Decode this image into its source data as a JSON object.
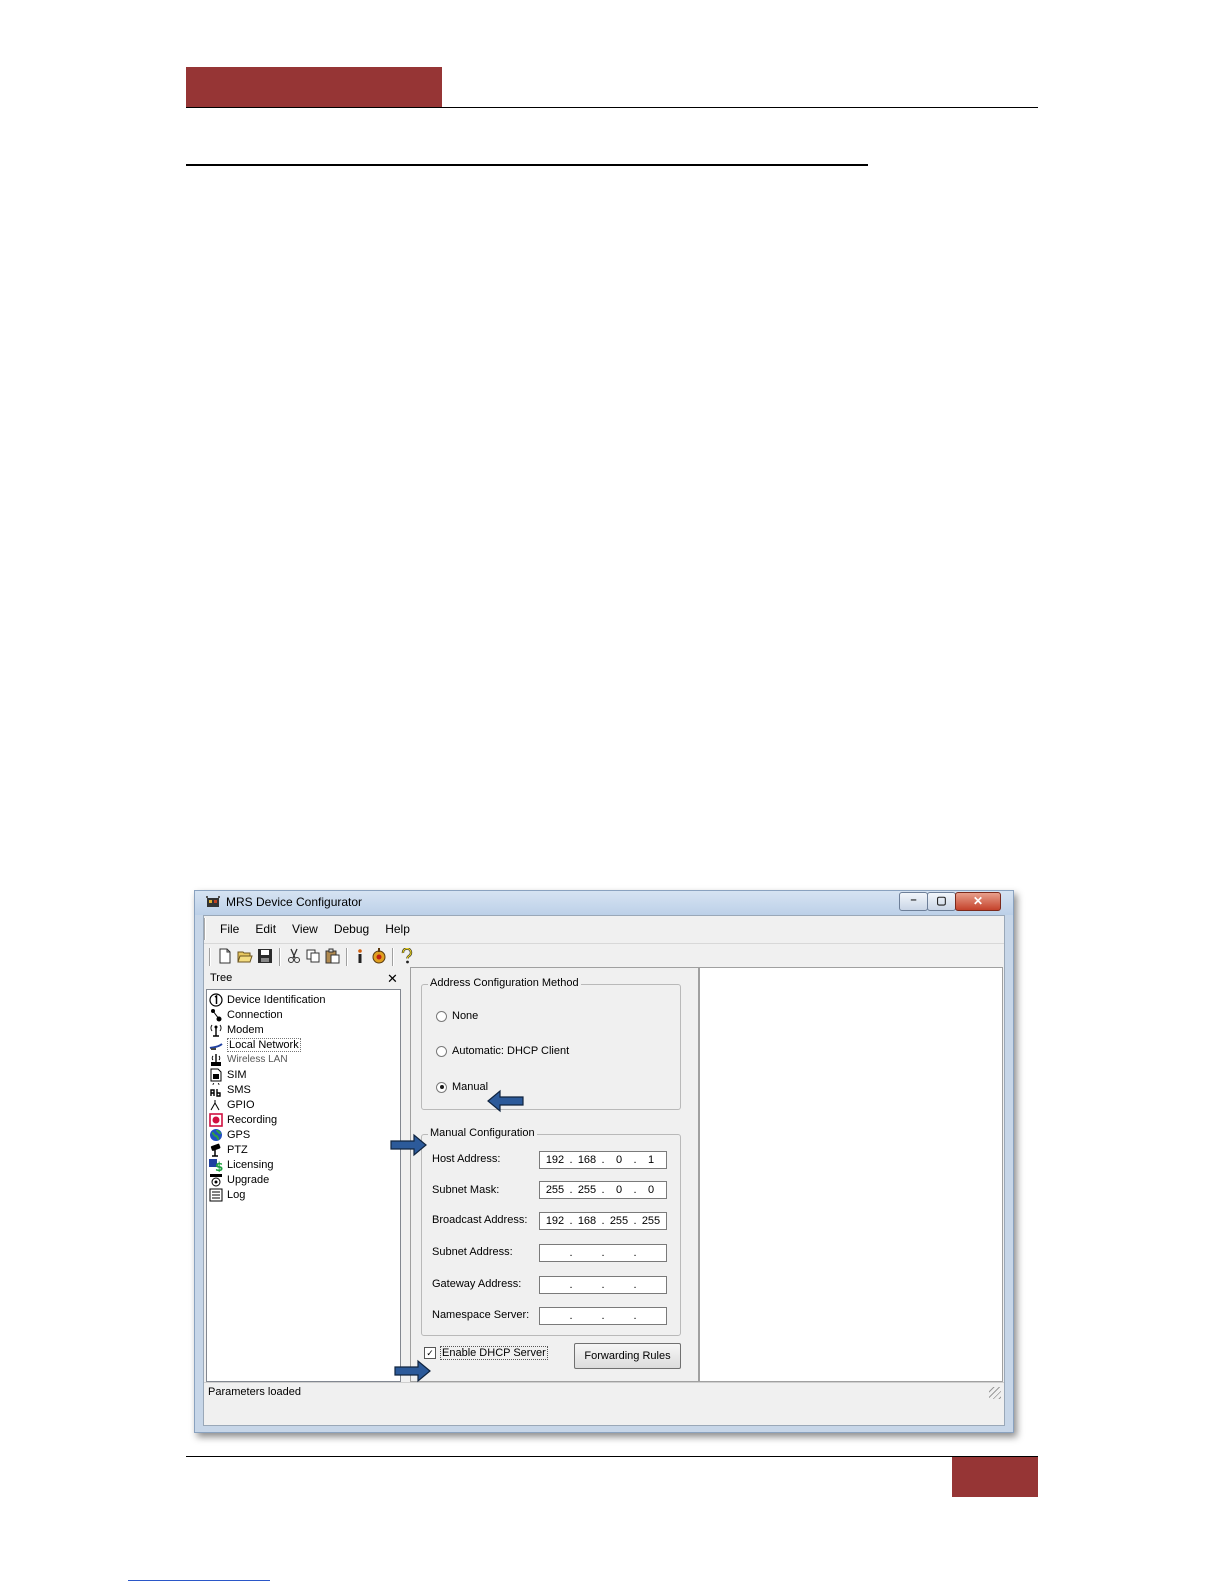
{
  "window": {
    "title": "MRS Device Configurator",
    "minimize_glyph": "–",
    "maximize_glyph": "▢",
    "close_glyph": "✕"
  },
  "menu": [
    "File",
    "Edit",
    "View",
    "Debug",
    "Help"
  ],
  "toolbar_icons": [
    "new-icon",
    "open-icon",
    "save-icon",
    "cut-icon",
    "copy-icon",
    "paste-icon",
    "info-icon",
    "settings-icon",
    "help-icon"
  ],
  "tree": {
    "title": "Tree",
    "close_glyph": "✕",
    "items": [
      {
        "label": "Device Identification",
        "icon": "device-id-icon"
      },
      {
        "label": "Connection",
        "icon": "connection-icon"
      },
      {
        "label": "Modem",
        "icon": "modem-icon"
      },
      {
        "label": "Local Network",
        "icon": "local-network-icon"
      },
      {
        "label": "Wireless LAN",
        "icon": "wireless-lan-icon"
      },
      {
        "label": "SIM",
        "icon": "sim-icon"
      },
      {
        "label": "SMS",
        "icon": "sms-icon"
      },
      {
        "label": "GPIO",
        "icon": "gpio-icon"
      },
      {
        "label": "Recording",
        "icon": "recording-icon"
      },
      {
        "label": "GPS",
        "icon": "gps-icon"
      },
      {
        "label": "PTZ",
        "icon": "ptz-icon"
      },
      {
        "label": "Licensing",
        "icon": "licensing-icon"
      },
      {
        "label": "Upgrade",
        "icon": "upgrade-icon"
      },
      {
        "label": "Log",
        "icon": "log-icon"
      }
    ],
    "selected": "Local Network"
  },
  "address_method": {
    "title": "Address Configuration Method",
    "options": [
      "None",
      "Automatic: DHCP Client",
      "Manual"
    ],
    "selected": "Manual"
  },
  "manual_config": {
    "title": "Manual Configuration",
    "fields": [
      {
        "label": "Host Address:",
        "octets": [
          "192",
          "168",
          "0",
          "1"
        ]
      },
      {
        "label": "Subnet Mask:",
        "octets": [
          "255",
          "255",
          "0",
          "0"
        ]
      },
      {
        "label": "Broadcast Address:",
        "octets": [
          "192",
          "168",
          "255",
          "255"
        ]
      },
      {
        "label": "Subnet Address:",
        "octets": [
          "",
          "",
          "",
          ""
        ]
      },
      {
        "label": "Gateway Address:",
        "octets": [
          "",
          "",
          "",
          ""
        ]
      },
      {
        "label": "Namespace Server:",
        "octets": [
          "",
          "",
          "",
          ""
        ]
      }
    ]
  },
  "dhcp_server": {
    "label": "Enable DHCP Server",
    "checked": true,
    "check_glyph": "✓"
  },
  "forwarding_button": "Forwarding Rules",
  "status": "Parameters loaded",
  "colors": {
    "accent_bar": "#963535",
    "arrow_fill": "#2c5a9a"
  }
}
